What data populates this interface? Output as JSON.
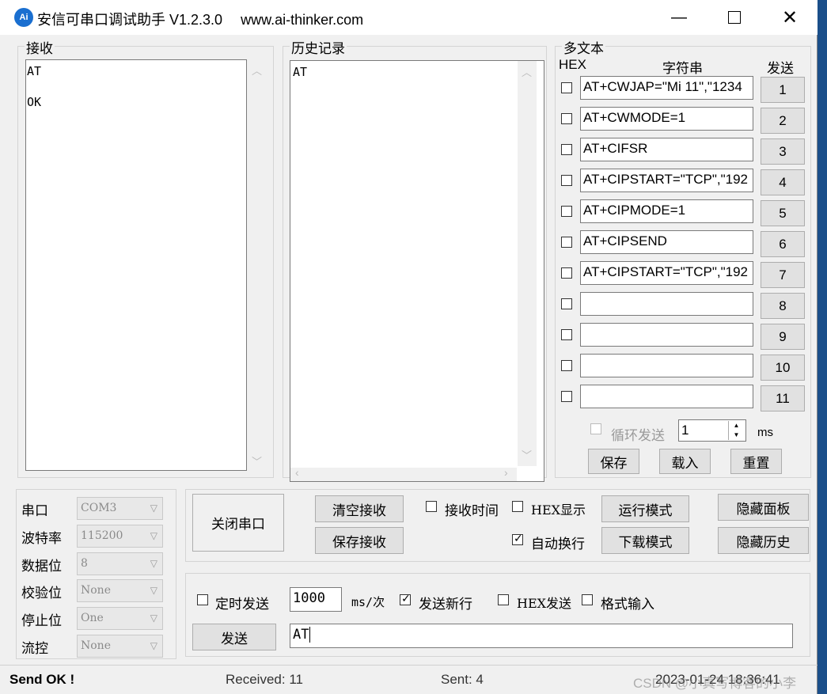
{
  "window": {
    "icon_label": "Ai",
    "title": "安信可串口调试助手 V1.2.3.0",
    "url": "www.ai-thinker.com"
  },
  "receive": {
    "label": "接收",
    "lines": [
      "AT",
      "OK"
    ]
  },
  "history": {
    "label": "历史记录",
    "lines": [
      "AT"
    ]
  },
  "multi": {
    "label": "多文本",
    "hex_header": "HEX",
    "string_header": "字符串",
    "send_header": "发送",
    "rows": [
      {
        "text": "AT+CWJAP=\"Mi 11\",\"1234",
        "num": "1"
      },
      {
        "text": "AT+CWMODE=1",
        "num": "2"
      },
      {
        "text": "AT+CIFSR",
        "num": "3"
      },
      {
        "text": "AT+CIPSTART=\"TCP\",\"192",
        "num": "4"
      },
      {
        "text": "AT+CIPMODE=1",
        "num": "5"
      },
      {
        "text": "AT+CIPSEND",
        "num": "6"
      },
      {
        "text": "AT+CIPSTART=\"TCP\",\"192",
        "num": "7"
      },
      {
        "text": "",
        "num": "8"
      },
      {
        "text": "",
        "num": "9"
      },
      {
        "text": "",
        "num": "10"
      },
      {
        "text": "",
        "num": "11"
      }
    ],
    "loop_label": "循环发送",
    "interval": "1",
    "unit": "ms",
    "save": "保存",
    "load": "载入",
    "reset": "重置"
  },
  "port": {
    "fields": [
      {
        "label": "串口",
        "value": "COM3"
      },
      {
        "label": "波特率",
        "value": "115200"
      },
      {
        "label": "数据位",
        "value": "8"
      },
      {
        "label": "校验位",
        "value": "None"
      },
      {
        "label": "停止位",
        "value": "One"
      },
      {
        "label": "流控",
        "value": "None"
      }
    ]
  },
  "controls": {
    "close_port": "关闭串口",
    "clear_recv": "清空接收",
    "save_recv": "保存接收",
    "recv_time": "接收时间",
    "hex_display": "HEX显示",
    "auto_newline": "自动换行",
    "run_mode": "运行模式",
    "download_mode": "下载模式",
    "hide_panel": "隐藏面板",
    "hide_history": "隐藏历史"
  },
  "send": {
    "timed_send": "定时发送",
    "period": "1000",
    "period_unit": "ms/次",
    "send_newline": "发送新行",
    "hex_send": "HEX发送",
    "format_input": "格式输入",
    "send_button": "发送",
    "input": "AT"
  },
  "status": {
    "left": "Send OK !",
    "received": "Received: 11",
    "sent": "Sent: 4",
    "time": "2023-01-24 18:36:41"
  },
  "watermark": "CSDN @小真写博客的小李",
  "colors": {
    "accent": "#1a6fd0",
    "desktop": "#1b4f8a"
  }
}
